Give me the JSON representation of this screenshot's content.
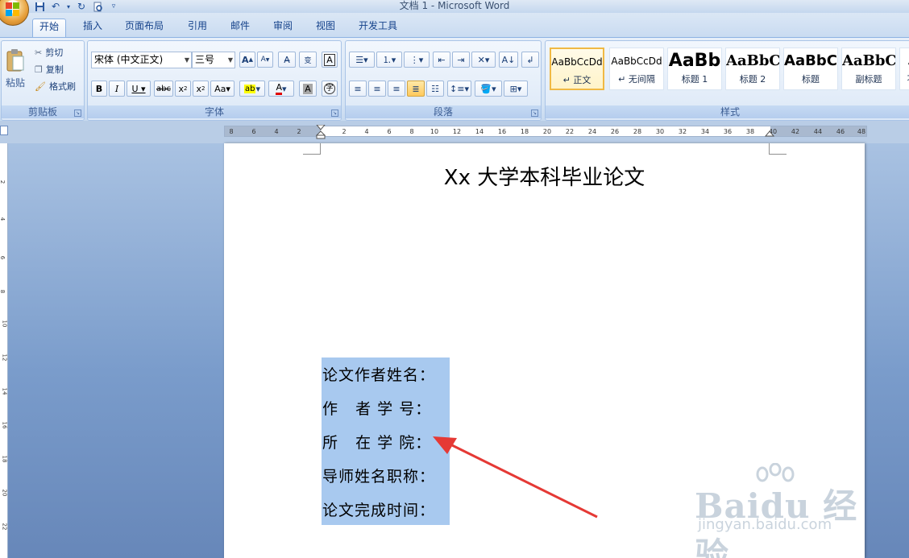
{
  "window": {
    "title": "文档 1 - Microsoft Word"
  },
  "quick_access": {
    "icons": [
      "save-icon",
      "undo-icon",
      "redo-icon",
      "print-preview-icon",
      "customize-icon"
    ]
  },
  "tabs": [
    {
      "label": "开始",
      "active": true
    },
    {
      "label": "插入"
    },
    {
      "label": "页面布局"
    },
    {
      "label": "引用"
    },
    {
      "label": "邮件"
    },
    {
      "label": "审阅"
    },
    {
      "label": "视图"
    },
    {
      "label": "开发工具"
    }
  ],
  "ribbon": {
    "clipboard": {
      "label": "剪贴板",
      "paste": "粘贴",
      "cut": "剪切",
      "copy": "复制",
      "format_painter": "格式刷"
    },
    "font": {
      "label": "字体",
      "font_name": "宋体 (中文正文)",
      "font_size": "三号"
    },
    "paragraph": {
      "label": "段落"
    },
    "styles": {
      "label": "样式",
      "items": [
        {
          "sample": "AaBbCcDd",
          "name": "↵ 正文"
        },
        {
          "sample": "AaBbCcDd",
          "name": "↵ 无间隔"
        },
        {
          "sample": "AaBb",
          "name": "标题 1"
        },
        {
          "sample": "AaBbC",
          "name": "标题 2"
        },
        {
          "sample": "AaBbC",
          "name": "标题"
        },
        {
          "sample": "AaBbC",
          "name": "副标题"
        },
        {
          "sample": "A",
          "name": "不"
        }
      ]
    }
  },
  "ruler": {
    "left_ticks": [
      "8",
      "6",
      "4",
      "2"
    ],
    "right_ticks": [
      "2",
      "4",
      "6",
      "8",
      "10",
      "12",
      "14",
      "16",
      "18",
      "20",
      "22",
      "24",
      "26",
      "28",
      "30",
      "32",
      "34",
      "36",
      "38",
      "40",
      "42",
      "44",
      "46",
      "48"
    ]
  },
  "vruler": {
    "ticks": [
      "2",
      "4",
      "6",
      "8",
      "10",
      "12",
      "14",
      "16",
      "18",
      "20",
      "22"
    ]
  },
  "document": {
    "title": "Xx 大学本科毕业论文",
    "fields": [
      "论文作者姓名：",
      "作   者 学 号：",
      "所   在 学 院：",
      "导师姓名职称：",
      "论文完成时间："
    ]
  },
  "watermark": {
    "logo": "Baidu 经验",
    "url": "jingyan.baidu.com"
  },
  "colors": {
    "selection": "#a8c9ef",
    "arrow": "#e53935",
    "accent": "#15428b"
  }
}
